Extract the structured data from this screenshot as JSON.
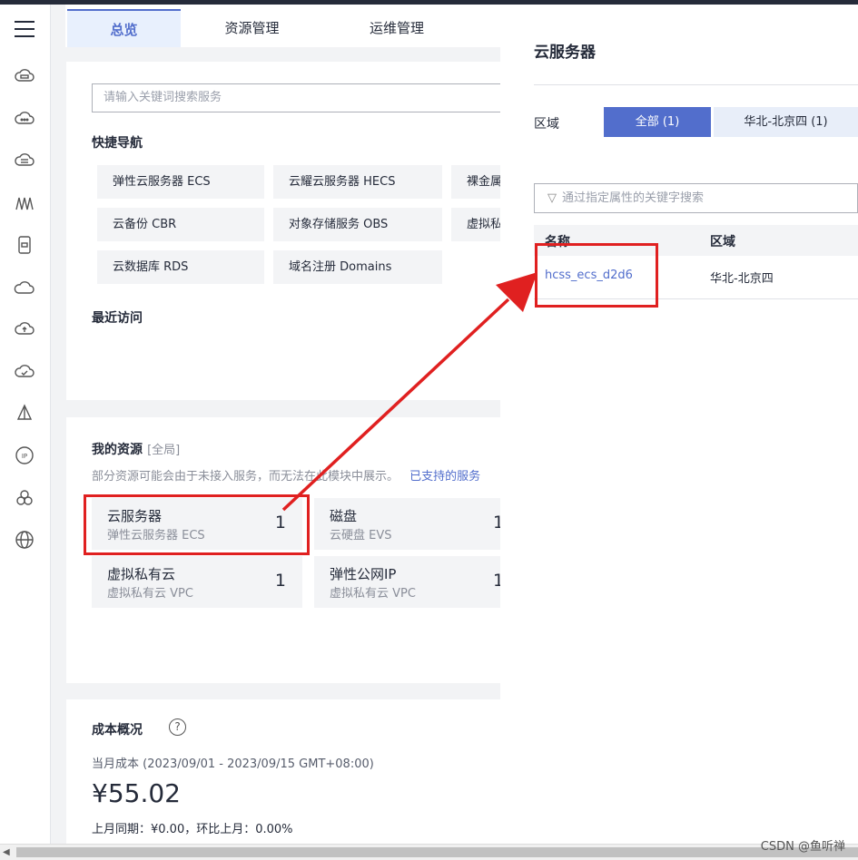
{
  "tabs": [
    "总览",
    "资源管理",
    "运维管理"
  ],
  "search": {
    "placeholder": "请输入关键词搜索服务"
  },
  "quick_nav": {
    "title": "快捷导航",
    "items": [
      "弹性云服务器 ECS",
      "云耀云服务器 HECS",
      "裸金属",
      "云备份 CBR",
      "对象存储服务 OBS",
      "虚拟私",
      "云数据库 RDS",
      "域名注册 Domains"
    ]
  },
  "recent": {
    "title": "最近访问"
  },
  "resources": {
    "title": "我的资源",
    "scope": "[全局]",
    "note": "部分资源可能会由于未接入服务，而无法在此模块中展示。",
    "link": "已支持的服务",
    "tiles": [
      {
        "name": "云服务器",
        "sub": "弹性云服务器 ECS",
        "count": "1"
      },
      {
        "name": "磁盘",
        "sub": "云硬盘 EVS",
        "count": "1"
      },
      {
        "name": "虚拟私有云",
        "sub": "虚拟私有云 VPC",
        "count": "1"
      },
      {
        "name": "弹性公网IP",
        "sub": "虚拟私有云 VPC",
        "count": "1"
      }
    ]
  },
  "cost": {
    "title": "成本概况",
    "help_icon": "?",
    "period": "当月成本 (2023/09/01 - 2023/09/15 GMT+08:00)",
    "amount": "¥55.02",
    "compare": "上月同期：¥0.00，环比上月：0.00%"
  },
  "panel": {
    "title": "云服务器",
    "region_label": "区域",
    "region_buttons": [
      "全部 (1)",
      "华北-北京四 (1)"
    ],
    "filter_placeholder": "通过指定属性的关键字搜索",
    "columns": [
      "名称",
      "区域"
    ],
    "rows": [
      {
        "name": "hcss_ecs_d2d6",
        "region": "华北-北京四"
      }
    ]
  },
  "watermark": "CSDN @鱼听禅",
  "colors": {
    "accent": "#526ecc",
    "link": "#526ecc",
    "annotation": "#e02020"
  },
  "rail_icons": [
    "menu-icon",
    "cloud-server-icon",
    "cloud-dots-icon",
    "cloud-db-icon",
    "network-icon",
    "phone-icon",
    "cloud-icon",
    "cloud-upload-icon",
    "cloud-check-icon",
    "sail-icon",
    "ip-icon",
    "clover-icon",
    "globe-icon"
  ]
}
